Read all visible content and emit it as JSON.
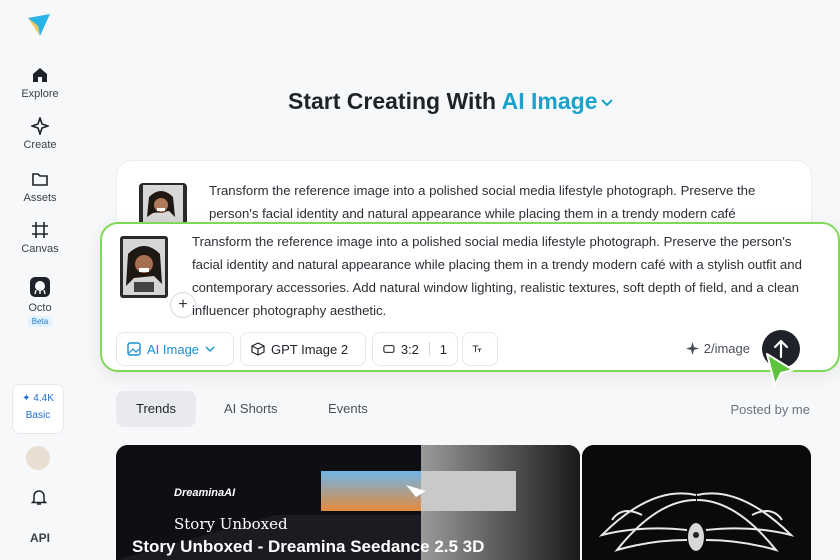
{
  "sidebar": {
    "items": [
      {
        "label": "Explore"
      },
      {
        "label": "Create"
      },
      {
        "label": "Assets"
      },
      {
        "label": "Canvas"
      },
      {
        "label": "Octo",
        "badge": "Beta"
      }
    ],
    "credits": {
      "amount": "4.4K",
      "level": "Basic"
    },
    "api_label": "API"
  },
  "header": {
    "prefix": "Start Creating With",
    "mode": "AI Image"
  },
  "prompt_bg": {
    "text": "Transform the reference image into a polished social media lifestyle photograph. Preserve the person's facial identity and natural appearance while placing them in a trendy modern café"
  },
  "prompt": {
    "text": "Transform the reference image into a polished social media lifestyle photograph. Preserve the person's facial identity and natural appearance while placing them in a trendy modern café with a stylish outfit and contemporary accessories. Add natural window lighting, realistic textures, soft depth of field, and a clean influencer photography aesthetic.",
    "add_symbol": "+"
  },
  "toolbar": {
    "mode": "AI Image",
    "model": "GPT Image 2",
    "ratio": "3:2",
    "count": "1",
    "cost": "2/image"
  },
  "tabs": [
    {
      "label": "Trends",
      "active": true
    },
    {
      "label": "AI Shorts"
    },
    {
      "label": "Events"
    }
  ],
  "posted_filter": "Posted by me",
  "gallery": [
    {
      "brand": "DreaminaAI",
      "subtitle": "Story Unboxed",
      "title": "Story Unboxed - Dreamina Seedance 2.5 3D"
    },
    {}
  ],
  "colors": {
    "accent": "#1aa3c9",
    "highlight": "#7ed957",
    "dark": "#1f2329"
  }
}
